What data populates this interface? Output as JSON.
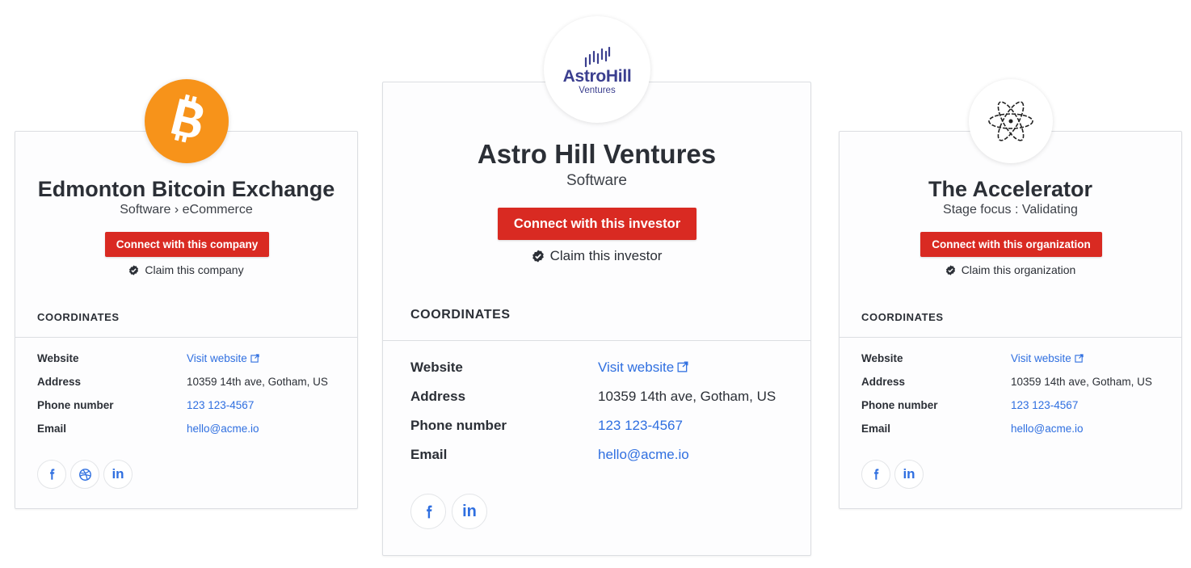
{
  "cards": [
    {
      "name": "Edmonton Bitcoin Exchange",
      "subtitle": "Software › eCommerce",
      "cta": "Connect with this company",
      "claim": "Claim this company",
      "section": "COORDINATES",
      "rows": [
        {
          "label": "Website",
          "value": "Visit website"
        },
        {
          "label": "Address",
          "value": "10359 14th ave, Gotham, US"
        },
        {
          "label": "Phone number",
          "value": "123 123-4567"
        },
        {
          "label": "Email",
          "value": "hello@acme.io"
        }
      ],
      "socials": [
        "facebook-icon",
        "dribbble-icon",
        "linkedin-icon"
      ],
      "logo_icon": "bitcoin-icon"
    },
    {
      "name": "Astro Hill Ventures",
      "subtitle": "Software",
      "cta": "Connect with this investor",
      "claim": "Claim this investor",
      "section": "COORDINATES",
      "rows": [
        {
          "label": "Website",
          "value": "Visit website"
        },
        {
          "label": "Address",
          "value": "10359 14th ave, Gotham, US"
        },
        {
          "label": "Phone number",
          "value": "123 123-4567"
        },
        {
          "label": "Email",
          "value": "hello@acme.io"
        }
      ],
      "socials": [
        "facebook-icon",
        "linkedin-icon"
      ],
      "logo_text": "AstroHill",
      "logo_subtext": "Ventures"
    },
    {
      "name": "The Accelerator",
      "subtitle": "Stage focus : Validating",
      "cta": "Connect with this organization",
      "claim": "Claim this organization",
      "section": "COORDINATES",
      "rows": [
        {
          "label": "Website",
          "value": "Visit website"
        },
        {
          "label": "Address",
          "value": "10359 14th ave, Gotham, US"
        },
        {
          "label": "Phone number",
          "value": "123 123-4567"
        },
        {
          "label": "Email",
          "value": "hello@acme.io"
        }
      ],
      "socials": [
        "facebook-icon",
        "linkedin-icon"
      ],
      "logo_icon": "atom-icon"
    }
  ],
  "colors": {
    "cta": "#d92a22",
    "link": "#2f6fe0",
    "bitcoin": "#f7931a",
    "astro_purple": "#3b3f8f"
  },
  "icons": {
    "verified": "check-badge-icon",
    "external": "external-link-icon",
    "linkedin_glyph": "in",
    "facebook_glyph": "f"
  }
}
